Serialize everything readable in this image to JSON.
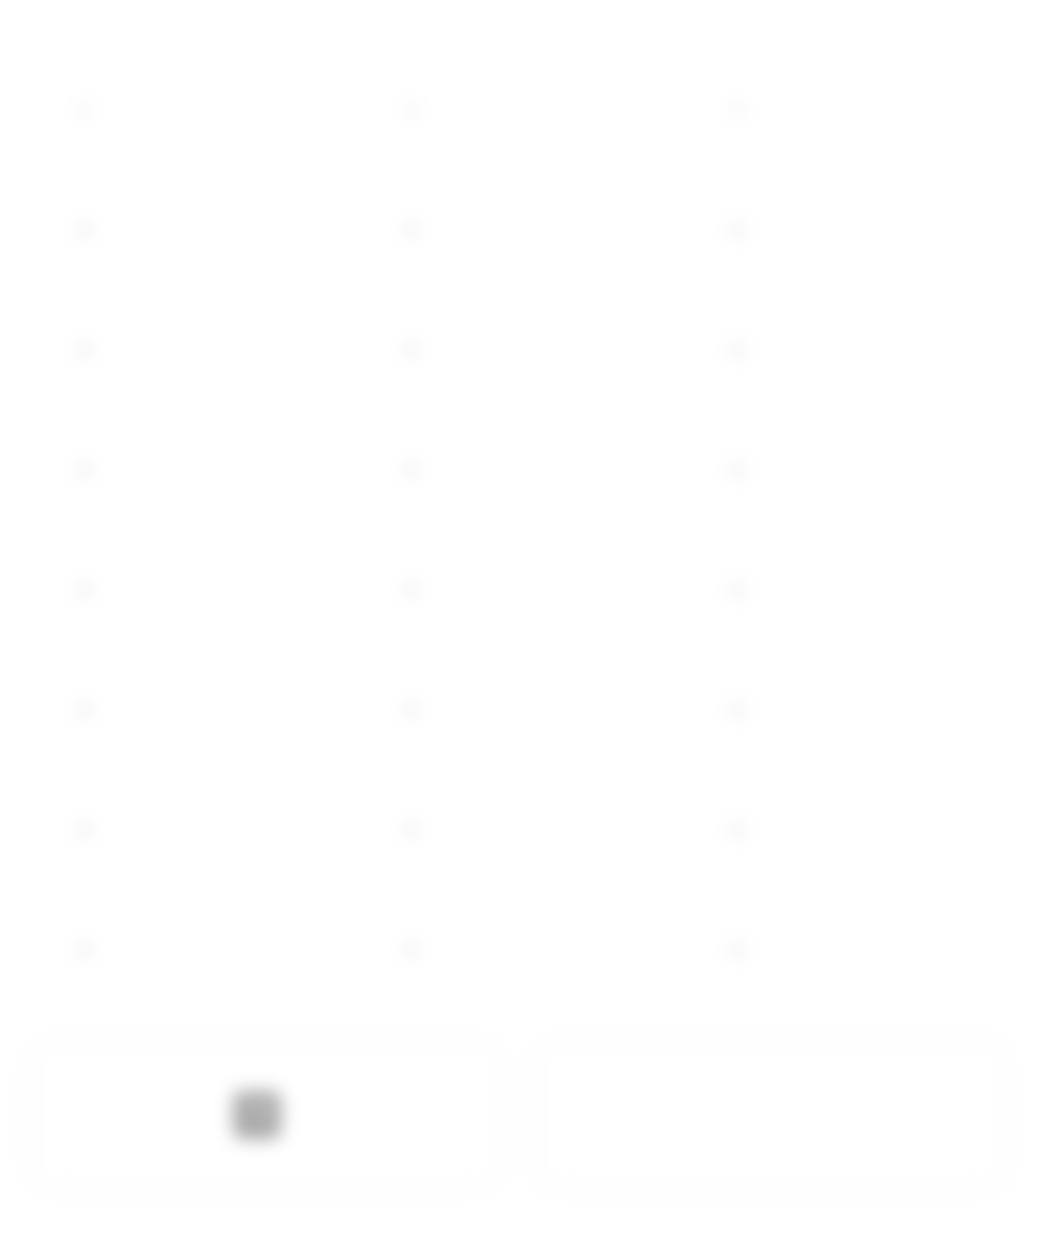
{
  "table": {
    "headers": [
      "",
      "",
      ""
    ],
    "rows": [
      [
        "",
        "",
        ""
      ],
      [
        "",
        "",
        ""
      ],
      [
        "",
        "",
        ""
      ],
      [
        "",
        "",
        ""
      ],
      [
        "",
        "",
        ""
      ],
      [
        "",
        "",
        ""
      ],
      [
        "",
        "",
        ""
      ]
    ]
  },
  "footer": {
    "left_button_label": "",
    "left_button_icon": "copy-icon",
    "right_button_label": ""
  },
  "colors": {
    "text": "#6f6f6f",
    "bullet": "#d9d9d9",
    "border": "#f2f2f2",
    "background": "#ffffff"
  }
}
